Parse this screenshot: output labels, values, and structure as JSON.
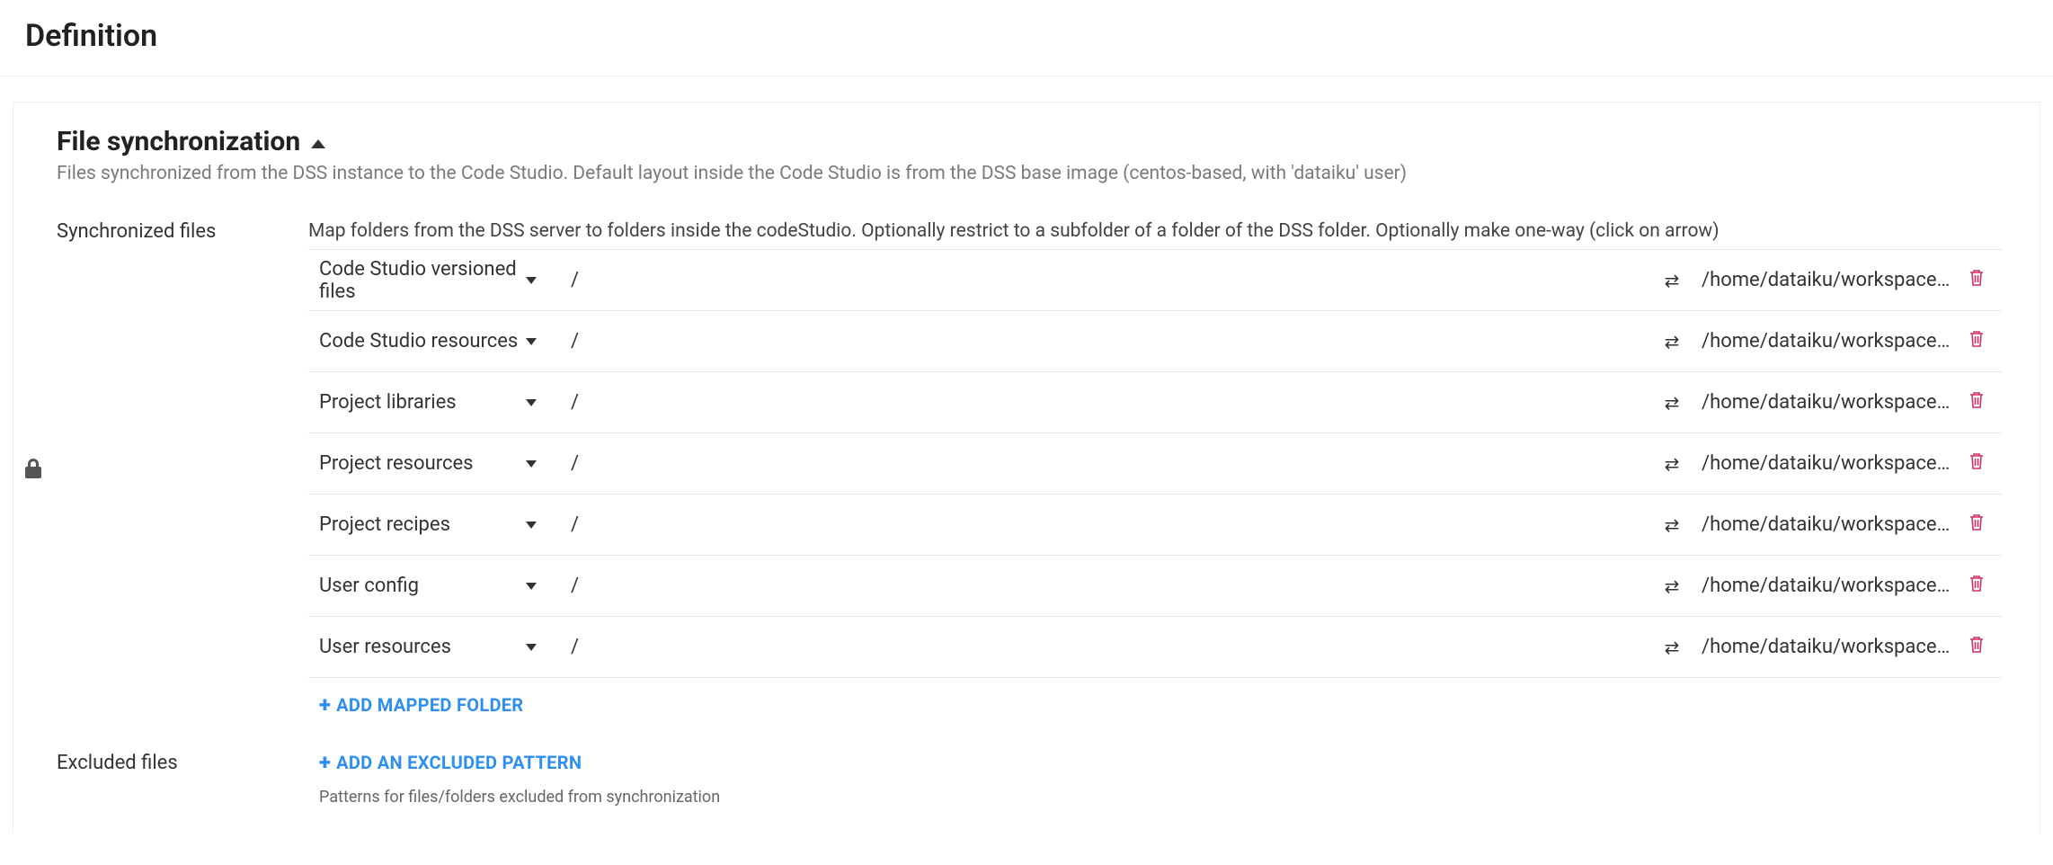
{
  "page": {
    "title": "Definition"
  },
  "section": {
    "title": "File synchronization",
    "description": "Files synchronized from the DSS instance to the Code Studio. Default layout inside the Code Studio is from the DSS base image (centos-based, with 'dataiku' user)"
  },
  "syncFiles": {
    "label": "Synchronized files",
    "helper": "Map folders from the DSS server to folders inside the codeStudio. Optionally restrict to a subfolder of a folder of the DSS folder. Optionally make one-way (click on arrow)",
    "addLabel": "ADD MAPPED FOLDER",
    "rows": [
      {
        "source": "Code Studio versioned files",
        "subpath": "/",
        "dest": "/home/dataiku/workspace/code_stu"
      },
      {
        "source": "Code Studio resources",
        "subpath": "/",
        "dest": "/home/dataiku/workspace/code_stu"
      },
      {
        "source": "Project libraries",
        "subpath": "/",
        "dest": "/home/dataiku/workspace/project-li"
      },
      {
        "source": "Project resources",
        "subpath": "/",
        "dest": "/home/dataiku/workspace/project-li"
      },
      {
        "source": "Project recipes",
        "subpath": "/",
        "dest": "/home/dataiku/workspace/recipes"
      },
      {
        "source": "User config",
        "subpath": "/",
        "dest": "/home/dataiku/workspace/user-vers"
      },
      {
        "source": "User resources",
        "subpath": "/",
        "dest": "/home/dataiku/workspace/user-resc"
      }
    ]
  },
  "excluded": {
    "label": "Excluded files",
    "addLabel": "ADD AN EXCLUDED PATTERN",
    "helper": "Patterns for files/folders excluded from synchronization"
  }
}
